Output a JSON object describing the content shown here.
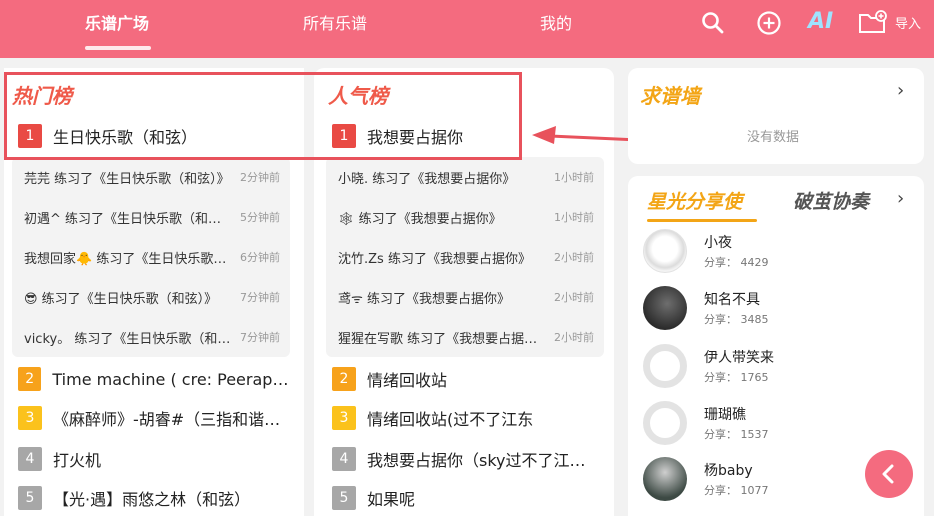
{
  "topbar": {
    "tabs": [
      "乐谱广场",
      "所有乐谱",
      "我的"
    ],
    "import_label": "导入",
    "ai_label": "AI",
    "icons": [
      "search-icon",
      "add-circle-icon",
      "ai-icon",
      "folder-add-icon"
    ]
  },
  "hot": {
    "title": "热门榜",
    "top": {
      "rank": "1",
      "name": "生日快乐歌（和弦）"
    },
    "activity": [
      {
        "text": "芫芫 练习了《生日快乐歌（和弦）》",
        "time": "2分钟前"
      },
      {
        "text": "初遇^ 练习了《生日快乐歌（和弦）》",
        "time": "5分钟前"
      },
      {
        "text": "我想回家🐥 练习了《生日快乐歌（和弦）》",
        "time": "6分钟前"
      },
      {
        "text": "😎 练习了《生日快乐歌（和弦）》",
        "time": "7分钟前"
      },
      {
        "text": "vicky。 练习了《生日快乐歌（和弦）》",
        "time": "7分钟前"
      }
    ],
    "list": [
      {
        "rank": "2",
        "name": "Time machine ( cre: Peerapet…"
      },
      {
        "rank": "3",
        "name": "《麻醉师》-胡睿#（三指和谐…"
      },
      {
        "rank": "4",
        "name": "打火机"
      },
      {
        "rank": "5",
        "name": "【光·遇】雨悠之林（和弦）"
      }
    ]
  },
  "popular": {
    "title": "人气榜",
    "top": {
      "rank": "1",
      "name": "我想要占据你"
    },
    "activity": [
      {
        "text": "小晓. 练习了《我想要占据你》",
        "time": "1小时前"
      },
      {
        "text": "🕸 练习了《我想要占据你》",
        "time": "1小时前"
      },
      {
        "text": "沈竹.Zs 练习了《我想要占据你》",
        "time": "2小时前"
      },
      {
        "text": "鸢ᯤ 练习了《我想要占据你》",
        "time": "2小时前"
      },
      {
        "text": "猩猩在写歌 练习了《我想要占据你》",
        "time": "2小时前"
      }
    ],
    "list": [
      {
        "rank": "2",
        "name": "情绪回收站"
      },
      {
        "rank": "3",
        "name": "情绪回收站(过不了江东"
      },
      {
        "rank": "4",
        "name": "我想要占据你（sky过不了江…"
      },
      {
        "rank": "5",
        "name": "如果呢"
      }
    ]
  },
  "request_wall": {
    "title": "求谱墙",
    "empty": "没有数据"
  },
  "sharers": {
    "tab_active": "星光分享使",
    "tab_other": "破茧协奏",
    "share_prefix": "分享：",
    "users": [
      {
        "name": "小夜",
        "shares": "4429"
      },
      {
        "name": "知名不具",
        "shares": "3485"
      },
      {
        "name": "伊人带笑来",
        "shares": "1765"
      },
      {
        "name": "珊瑚礁",
        "shares": "1537"
      },
      {
        "name": "杨baby",
        "shares": "1077"
      }
    ]
  },
  "colors": {
    "brand": "#f46b7f",
    "rank1": "#e94a44",
    "rank2": "#f7a21b",
    "rank3": "#fbc21c",
    "rank4": "#a7a7a7",
    "accent_title": "#f3a516"
  }
}
